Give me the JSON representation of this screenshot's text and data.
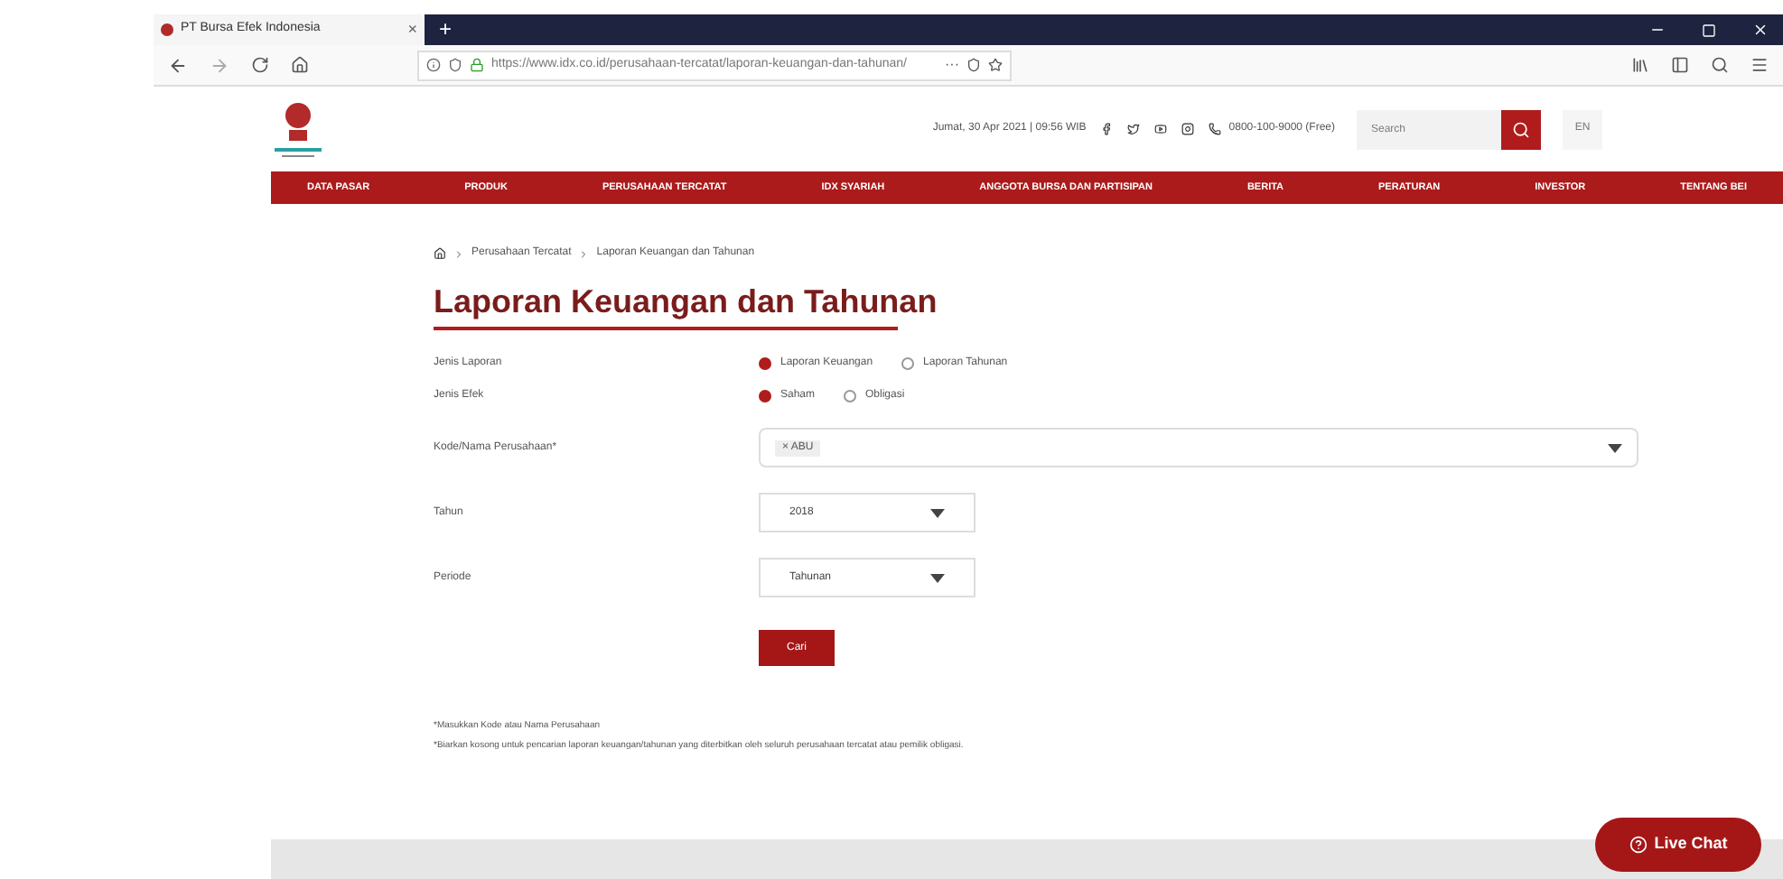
{
  "browser": {
    "tab_title": "PT Bursa Efek Indonesia",
    "tab_close": "×",
    "new_tab": "+",
    "url": "https://www.idx.co.id/perusahaan-tercatat/laporan-keuangan-dan-tahunan/",
    "more": "···"
  },
  "header": {
    "datetime": "Jumat, 30 Apr 2021 | 09:56 WIB",
    "phone": "0800-100-9000 (Free)",
    "search": {
      "placeholder": "Search"
    },
    "language": "EN"
  },
  "nav": [
    "DATA PASAR",
    "PRODUK",
    "PERUSAHAAN TERCATAT",
    "IDX SYARIAH",
    "ANGGOTA BURSA DAN PARTISIPAN",
    "BERITA",
    "PERATURAN",
    "INVESTOR",
    "TENTANG BEI"
  ],
  "breadcrumb": [
    "Perusahaan Tercatat",
    "Laporan Keuangan dan Tahunan"
  ],
  "title": "Laporan Keuangan dan Tahunan",
  "form": {
    "radio_groups": [
      {
        "label": "Jenis Laporan",
        "options": [
          {
            "label": "Laporan Keuangan",
            "selected": true
          },
          {
            "label": "Laporan Tahunan",
            "selected": false
          }
        ]
      },
      {
        "label": "Jenis Efek",
        "options": [
          {
            "label": "Saham",
            "selected": true
          },
          {
            "label": "Obligasi",
            "selected": false
          }
        ]
      }
    ],
    "company": {
      "label": "Kode/Nama Perusahaan*",
      "tag": "× ABU"
    },
    "selects": [
      {
        "label": "Tahun",
        "value": "2018"
      },
      {
        "label": "Periode",
        "value": "Tahunan"
      }
    ],
    "submit": "Cari"
  },
  "notes": [
    "*Masukkan Kode atau Nama Perusahaan",
    "*Biarkan kosong untuk pencarian laporan keuangan/tahunan yang diterbitkan oleh seluruh perusahaan tercatat atau pemilik obligasi."
  ],
  "live_chat": "Live Chat"
}
